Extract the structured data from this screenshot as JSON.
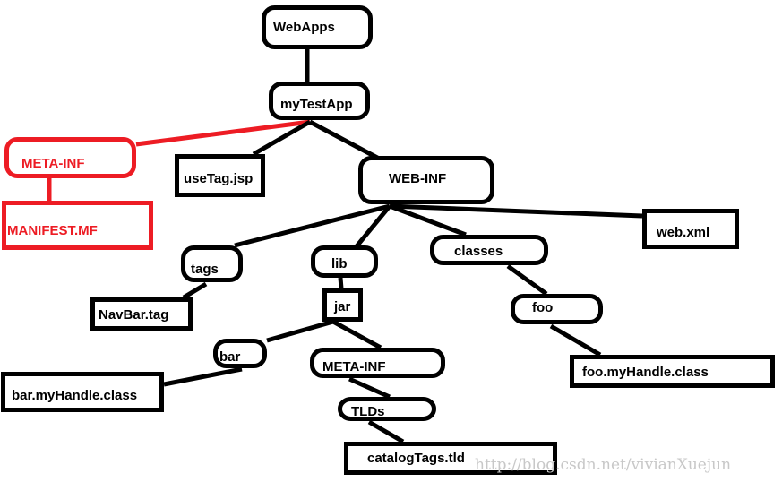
{
  "diagram": {
    "nodes": [
      {
        "id": "webapps",
        "label": "WebApps",
        "shape": "rounded",
        "color": "#000000"
      },
      {
        "id": "mytestapp",
        "label": "myTestApp",
        "shape": "rounded",
        "color": "#000000"
      },
      {
        "id": "meta-inf-red",
        "label": "META-INF",
        "shape": "rounded",
        "color": "#ed1c24"
      },
      {
        "id": "manifest",
        "label": "MANIFEST.MF",
        "shape": "rect",
        "color": "#ed1c24"
      },
      {
        "id": "usetag",
        "label": "useTag.jsp",
        "shape": "rect",
        "color": "#000000"
      },
      {
        "id": "web-inf",
        "label": "WEB-INF",
        "shape": "rounded",
        "color": "#000000"
      },
      {
        "id": "webxml",
        "label": "web.xml",
        "shape": "rect",
        "color": "#000000"
      },
      {
        "id": "tags",
        "label": "tags",
        "shape": "rounded",
        "color": "#000000"
      },
      {
        "id": "lib",
        "label": "lib",
        "shape": "rounded",
        "color": "#000000"
      },
      {
        "id": "classes",
        "label": "classes",
        "shape": "rounded",
        "color": "#000000"
      },
      {
        "id": "navbar",
        "label": "NavBar.tag",
        "shape": "rect",
        "color": "#000000"
      },
      {
        "id": "jar",
        "label": "jar",
        "shape": "rect",
        "color": "#000000"
      },
      {
        "id": "foo",
        "label": "foo",
        "shape": "rounded",
        "color": "#000000"
      },
      {
        "id": "bar",
        "label": "bar",
        "shape": "rounded",
        "color": "#000000"
      },
      {
        "id": "meta-inf-jar",
        "label": "META-INF",
        "shape": "rounded",
        "color": "#000000"
      },
      {
        "id": "bar-handle",
        "label": "bar.myHandle.class",
        "shape": "rect",
        "color": "#000000"
      },
      {
        "id": "foo-handle",
        "label": "foo.myHandle.class",
        "shape": "rect",
        "color": "#000000"
      },
      {
        "id": "tlds",
        "label": "TLDs",
        "shape": "rounded",
        "color": "#000000"
      },
      {
        "id": "catalog",
        "label": "catalogTags.tld",
        "shape": "rect",
        "color": "#000000"
      }
    ],
    "edges": [
      {
        "from": "webapps",
        "to": "mytestapp",
        "color": "#000000"
      },
      {
        "from": "mytestapp",
        "to": "meta-inf-red",
        "color": "#ed1c24"
      },
      {
        "from": "mytestapp",
        "to": "usetag",
        "color": "#000000"
      },
      {
        "from": "mytestapp",
        "to": "web-inf",
        "color": "#000000"
      },
      {
        "from": "meta-inf-red",
        "to": "manifest",
        "color": "#ed1c24"
      },
      {
        "from": "web-inf",
        "to": "tags",
        "color": "#000000"
      },
      {
        "from": "web-inf",
        "to": "lib",
        "color": "#000000"
      },
      {
        "from": "web-inf",
        "to": "classes",
        "color": "#000000"
      },
      {
        "from": "web-inf",
        "to": "webxml",
        "color": "#000000"
      },
      {
        "from": "tags",
        "to": "navbar",
        "color": "#000000"
      },
      {
        "from": "lib",
        "to": "jar",
        "color": "#000000"
      },
      {
        "from": "jar",
        "to": "bar",
        "color": "#000000"
      },
      {
        "from": "jar",
        "to": "meta-inf-jar",
        "color": "#000000"
      },
      {
        "from": "bar",
        "to": "bar-handle",
        "color": "#000000"
      },
      {
        "from": "meta-inf-jar",
        "to": "tlds",
        "color": "#000000"
      },
      {
        "from": "tlds",
        "to": "catalog",
        "color": "#000000"
      },
      {
        "from": "classes",
        "to": "foo",
        "color": "#000000"
      },
      {
        "from": "foo",
        "to": "foo-handle",
        "color": "#000000"
      }
    ]
  },
  "watermark": "http://blog.csdn.net/vivianXuejun"
}
